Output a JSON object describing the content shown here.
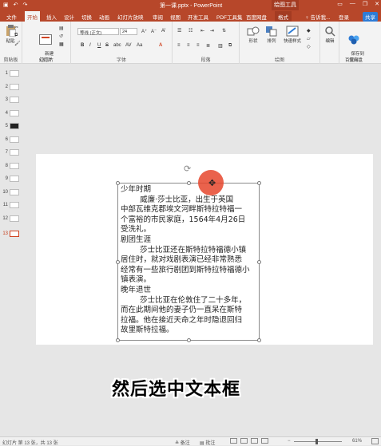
{
  "titlebar": {
    "title": "第一课.pptx - PowerPoint",
    "context_tab": "绘图工具",
    "qa_icons": [
      "save-icon",
      "undo-icon",
      "redo-icon"
    ]
  },
  "tabs": [
    {
      "label": "文件"
    },
    {
      "label": "开始"
    },
    {
      "label": "插入"
    },
    {
      "label": "设计"
    },
    {
      "label": "切换"
    },
    {
      "label": "动画"
    },
    {
      "label": "幻灯片放映"
    },
    {
      "label": "审阅"
    },
    {
      "label": "视图"
    },
    {
      "label": "开发工具"
    },
    {
      "label": "PDF工具集"
    },
    {
      "label": "百度网盘"
    },
    {
      "label": "格式"
    }
  ],
  "tellme": "♀ 告诉我...",
  "login": "登录",
  "share": "共享",
  "ribbon": {
    "clipboard": {
      "paste": "粘贴",
      "label": "剪贴板"
    },
    "slides": {
      "new_slide": "新建\n幻灯片",
      "label": "幻灯片"
    },
    "font": {
      "font_name": "等线 (正文)",
      "font_size": "24",
      "buttons": [
        "B",
        "I",
        "U",
        "S",
        "abc",
        "AV",
        "Aa",
        "A"
      ],
      "label": "字体"
    },
    "paragraph": {
      "label": "段落"
    },
    "drawing": {
      "shape": "形状",
      "arrange": "排列",
      "quick_styles": "快速样式",
      "label": "绘图"
    },
    "editing": {
      "edit": "编辑"
    },
    "save": {
      "save_to": "保存到\n百度网盘",
      "label": "保存"
    }
  },
  "thumbnails": [
    {
      "n": "1"
    },
    {
      "n": "2"
    },
    {
      "n": "3"
    },
    {
      "n": "4"
    },
    {
      "n": "5"
    },
    {
      "n": "6"
    },
    {
      "n": "7"
    },
    {
      "n": "8"
    },
    {
      "n": "9"
    },
    {
      "n": "10"
    },
    {
      "n": "11"
    },
    {
      "n": "12"
    },
    {
      "n": "13",
      "selected": true
    }
  ],
  "slide": {
    "textbox_text": "少年时期\n        威廉·莎士比亚，出生于英国\n中部瓦维克郡埃文河畔斯特拉特福一\n个富裕的市民家庭，1564年4月26日\n受洗礼。\n剧团生涯\n        莎士比亚还在斯特拉特福德小镇\n居住时，就对戏剧表演已经非常熟悉\n经常有一些旅行剧团到斯特拉特福德小\n镇表演。\n晚年退世\n        莎士比亚在伦敦住了二十多年，\n而在此期间他的妻子仍一直呆在斯特\n拉福。他在接近天命之年时隐退回归\n故里斯特拉福。"
  },
  "subtitle": "然后选中文本框",
  "status": {
    "slide_info": "幻灯片 第 13 张，共 13 张",
    "notes": "≜ 备注",
    "comments": "▤ 批注",
    "zoom": "61%"
  },
  "colors": {
    "accent": "#b7472a",
    "cursor": "#e6462d"
  }
}
